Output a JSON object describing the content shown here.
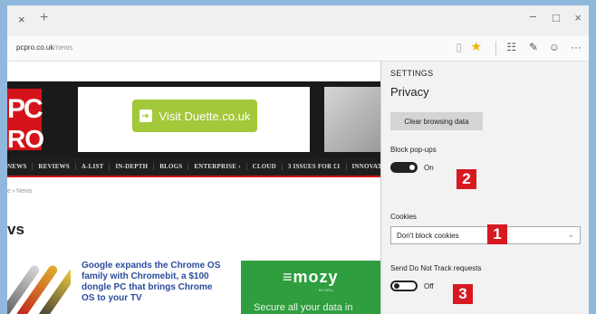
{
  "browser": {
    "tab_close": "×",
    "tab_add": "+",
    "window_controls": {
      "minimize": "–",
      "maximize": "□",
      "close": "×"
    },
    "url_domain": "pcpro.co.uk",
    "url_path": "/news",
    "toolbar_icons": [
      "reading-view-icon",
      "favorite-star-icon",
      "hub-icon",
      "web-note-icon",
      "feedback-smile-icon",
      "more-icon"
    ],
    "toolbar_glyphs": {
      "reading": "▯",
      "star": "★",
      "hub": "☷",
      "note": "✎",
      "smile": "☺",
      "more": "···"
    }
  },
  "page": {
    "logo_top": "PC",
    "logo_bottom": "RO",
    "ad_label": "Visit Duette.co.uk",
    "ad_arrow": "➜",
    "nav": [
      "NEWS",
      "REVIEWS",
      "A-LIST",
      "IN-DEPTH",
      "BLOGS",
      "ENTERPRISE ›",
      "CLOUD",
      "3 ISSUES FOR £1",
      "INNOVATION ‹"
    ],
    "breadcrumb_link": "e",
    "breadcrumb_sep": " › ",
    "breadcrumb_current": "News",
    "section_title": "vs",
    "article_headline": "Google expands the Chrome OS family with Chromebit, a $100 dongle PC that brings Chrome OS to your TV",
    "mozy_logo": "≡mozy",
    "mozy_sub": "BY DELL",
    "mozy_text": "Secure all your data in"
  },
  "settings": {
    "title": "SETTINGS",
    "section": "Privacy",
    "clear_button": "Clear browsing data",
    "popups_label": "Block pop-ups",
    "popups_state": "On",
    "cookies_label": "Cookies",
    "cookies_value": "Don't block cookies",
    "dnt_label": "Send Do Not Track requests",
    "dnt_state": "Off"
  },
  "annotations": {
    "badge_1": "1",
    "badge_2": "2",
    "badge_3": "3"
  },
  "colors": {
    "window_border": "#8fb8dc",
    "brand_red": "#d4131a",
    "ad_green": "#a3c83a",
    "mozy_green": "#2f9e3f",
    "badge_red": "#d71920",
    "link_blue": "#2a4c9c"
  }
}
